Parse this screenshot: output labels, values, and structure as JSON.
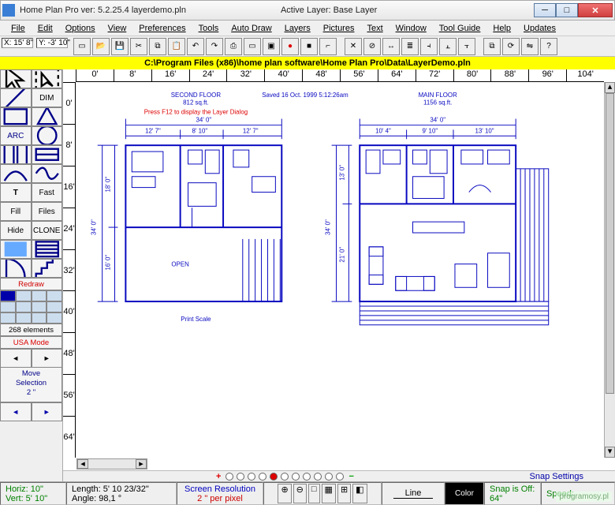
{
  "title": "Home Plan Pro ver: 5.2.25.4    layerdemo.pln",
  "activeLayer": "Active Layer: Base Layer",
  "menu": [
    "File",
    "Edit",
    "Options",
    "View",
    "Preferences",
    "Tools",
    "Auto Draw",
    "Layers",
    "Pictures",
    "Text",
    "Window",
    "Tool Guide",
    "Help",
    "Updates"
  ],
  "coords": {
    "x": "X: 15' 8\"",
    "y": "Y: -3' 10\""
  },
  "toolbar_icons": [
    "new",
    "open",
    "save",
    "cut",
    "copy",
    "paste",
    "undo",
    "redo",
    "print",
    "rect",
    "select",
    "marker-red",
    "marker-black",
    "door",
    "",
    "delete",
    "cancel",
    "measure",
    "layers",
    "align",
    "center",
    "align2",
    "",
    "copy2",
    "rotate",
    "flip",
    "query"
  ],
  "filePath": "C:\\Program Files (x86)\\home plan software\\Home Plan Pro\\Data\\LayerDemo.pln",
  "rulerH": [
    "0'",
    "8'",
    "16'",
    "24'",
    "32'",
    "40'",
    "48'",
    "56'",
    "64'",
    "72'",
    "80'",
    "88'",
    "96'",
    "104'"
  ],
  "rulerV": [
    "0'",
    "8'",
    "16'",
    "24'",
    "32'",
    "40'",
    "48'",
    "56'",
    "64'"
  ],
  "side": {
    "buttons": [
      {
        "name": "arrow",
        "svg": "arrow",
        "red": true
      },
      {
        "name": "select",
        "svg": "select"
      },
      {
        "name": "line",
        "svg": "line"
      },
      {
        "name": "dim",
        "label": "DIM"
      },
      {
        "name": "rect",
        "svg": "rect"
      },
      {
        "name": "polygon",
        "svg": "poly"
      },
      {
        "name": "arc",
        "label": "ARC",
        "blue": true
      },
      {
        "name": "circle",
        "svg": "circle"
      },
      {
        "name": "wall",
        "svg": "wall"
      },
      {
        "name": "window",
        "svg": "window"
      },
      {
        "name": "curve",
        "svg": "curve"
      },
      {
        "name": "curve2",
        "svg": "curve2"
      },
      {
        "name": "text",
        "label": "T",
        "bold": true
      },
      {
        "name": "fast",
        "label": "Fast"
      },
      {
        "name": "fill",
        "label": "Fill"
      },
      {
        "name": "files",
        "label": "Files"
      },
      {
        "name": "hide",
        "label": "Hide"
      },
      {
        "name": "clone",
        "label": "CLONE"
      },
      {
        "name": "gradient",
        "svg": "grad"
      },
      {
        "name": "pattern",
        "svg": "patt"
      },
      {
        "name": "door",
        "svg": "door"
      },
      {
        "name": "stairs",
        "svg": "stairs"
      }
    ],
    "redraw": "Redraw",
    "elements": "268 elements",
    "mode": "USA Mode",
    "move": "Move\nSelection\n2 \""
  },
  "plan": {
    "floor1": {
      "title": "SECOND FLOOR",
      "area": "812 sq.ft.",
      "hint": "Press  F12   to display the Layer Dialog",
      "width": "34' 0\"",
      "dims_top": [
        "12' 7\"",
        "8' 10\"",
        "12' 7\""
      ],
      "height": "34' 0\"",
      "dims_left": [
        "18' 0\"",
        "16' 0\""
      ],
      "open": "OPEN"
    },
    "floor2": {
      "title": "MAIN FLOOR",
      "area": "1156 sq.ft.",
      "width": "34' 0\"",
      "dims_top": [
        "10' 4\"",
        "9' 10\"",
        "13' 10\""
      ],
      "height": "34' 0\"",
      "dims_left": [
        "13' 0\"",
        "21' 0\""
      ]
    },
    "saved": "Saved 16 Oct. 1999  5:12:26am",
    "printScale": "Print Scale"
  },
  "snapSettings": "Snap Settings",
  "status": {
    "horiz": "Horiz: 10\"",
    "vert": "Vert: 5' 10\"",
    "length": "Length: 5' 10 23/32\"",
    "angle": "Angle:   98,1 °",
    "resolution": "Screen Resolution",
    "resValue": "2 \" per pixel",
    "line": "Line",
    "color": "Color",
    "snap": "Snap is Off:\n64\"",
    "speed": "Speed:"
  },
  "watermark": "programosy.pl"
}
